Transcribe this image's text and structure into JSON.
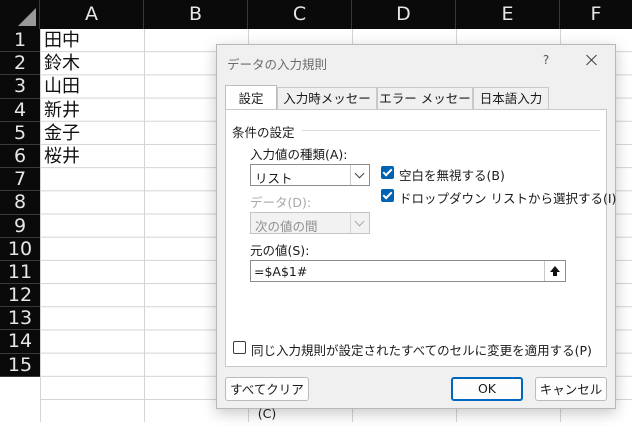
{
  "sheet": {
    "columns": [
      "A",
      "B",
      "C",
      "D",
      "E",
      "F"
    ],
    "rows": [
      "1",
      "2",
      "3",
      "4",
      "5",
      "6",
      "7",
      "8",
      "9",
      "10",
      "11",
      "12",
      "13",
      "14",
      "15"
    ],
    "cells": [
      {
        "row": "1",
        "value": "田中"
      },
      {
        "row": "2",
        "value": "鈴木"
      },
      {
        "row": "3",
        "value": "山田"
      },
      {
        "row": "4",
        "value": "新井"
      },
      {
        "row": "5",
        "value": "金子"
      },
      {
        "row": "6",
        "value": "桜井"
      }
    ]
  },
  "dialog": {
    "title": "データの入力規則",
    "help": "?",
    "tabs": [
      "設定",
      "入力時メッセージ",
      "エラー メッセージ",
      "日本語入力"
    ],
    "active_tab": "設定",
    "group_label": "条件の設定",
    "allow_label": "入力値の種類(A):",
    "allow_value": "リスト",
    "data_label": "データ(D):",
    "data_value": "次の値の間",
    "ignore_blank_label": "空白を無視する(B)",
    "ignore_blank_checked": true,
    "dropdown_label": "ドロップダウン リストから選択する(I)",
    "dropdown_checked": true,
    "source_label": "元の値(S):",
    "source_value": "=$A$1#",
    "apply_all_label": "同じ入力規則が設定されたすべてのセルに変更を適用する(P)",
    "apply_all_checked": false,
    "clear_button": "すべてクリア(C)",
    "ok_button": "OK",
    "cancel_button": "キャンセル"
  },
  "colors": {
    "accent": "#0063b1",
    "header_bg": "#0a0a0a",
    "header_text": "#e6e6e6"
  }
}
